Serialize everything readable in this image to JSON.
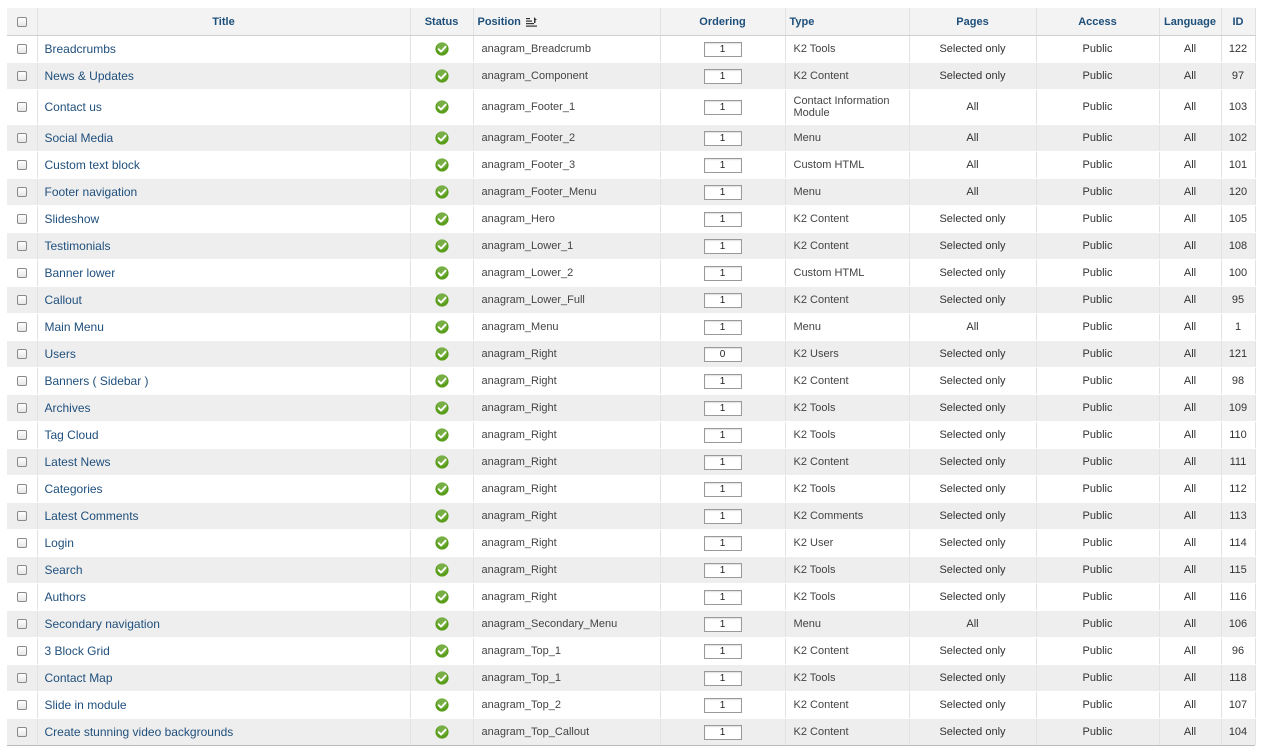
{
  "table": {
    "headers": {
      "title": "Title",
      "status": "Status",
      "position": "Position",
      "ordering": "Ordering",
      "type": "Type",
      "pages": "Pages",
      "access": "Access",
      "language": "Language",
      "id": "ID"
    },
    "status_color": "#5a9e1c",
    "rows": [
      {
        "title": "Breadcrumbs",
        "position": "anagram_Breadcrumb",
        "ordering": "1",
        "type": "K2 Tools",
        "pages": "Selected only",
        "access": "Public",
        "language": "All",
        "id": "122",
        "status": "published"
      },
      {
        "title": "News & Updates",
        "position": "anagram_Component",
        "ordering": "1",
        "type": "K2 Content",
        "pages": "Selected only",
        "access": "Public",
        "language": "All",
        "id": "97",
        "status": "published"
      },
      {
        "title": "Contact us",
        "position": "anagram_Footer_1",
        "ordering": "1",
        "type": "Contact Information Module",
        "pages": "All",
        "access": "Public",
        "language": "All",
        "id": "103",
        "status": "published"
      },
      {
        "title": "Social Media",
        "position": "anagram_Footer_2",
        "ordering": "1",
        "type": "Menu",
        "pages": "All",
        "access": "Public",
        "language": "All",
        "id": "102",
        "status": "published"
      },
      {
        "title": "Custom text block",
        "position": "anagram_Footer_3",
        "ordering": "1",
        "type": "Custom HTML",
        "pages": "All",
        "access": "Public",
        "language": "All",
        "id": "101",
        "status": "published"
      },
      {
        "title": "Footer navigation",
        "position": "anagram_Footer_Menu",
        "ordering": "1",
        "type": "Menu",
        "pages": "All",
        "access": "Public",
        "language": "All",
        "id": "120",
        "status": "published"
      },
      {
        "title": "Slideshow",
        "position": "anagram_Hero",
        "ordering": "1",
        "type": "K2 Content",
        "pages": "Selected only",
        "access": "Public",
        "language": "All",
        "id": "105",
        "status": "published"
      },
      {
        "title": "Testimonials",
        "position": "anagram_Lower_1",
        "ordering": "1",
        "type": "K2 Content",
        "pages": "Selected only",
        "access": "Public",
        "language": "All",
        "id": "108",
        "status": "published"
      },
      {
        "title": "Banner lower",
        "position": "anagram_Lower_2",
        "ordering": "1",
        "type": "Custom HTML",
        "pages": "Selected only",
        "access": "Public",
        "language": "All",
        "id": "100",
        "status": "published"
      },
      {
        "title": "Callout",
        "position": "anagram_Lower_Full",
        "ordering": "1",
        "type": "K2 Content",
        "pages": "Selected only",
        "access": "Public",
        "language": "All",
        "id": "95",
        "status": "published"
      },
      {
        "title": "Main Menu",
        "position": "anagram_Menu",
        "ordering": "1",
        "type": "Menu",
        "pages": "All",
        "access": "Public",
        "language": "All",
        "id": "1",
        "status": "published"
      },
      {
        "title": "Users",
        "position": "anagram_Right",
        "ordering": "0",
        "type": "K2 Users",
        "pages": "Selected only",
        "access": "Public",
        "language": "All",
        "id": "121",
        "status": "published"
      },
      {
        "title": "Banners ( Sidebar )",
        "position": "anagram_Right",
        "ordering": "1",
        "type": "K2 Content",
        "pages": "Selected only",
        "access": "Public",
        "language": "All",
        "id": "98",
        "status": "published"
      },
      {
        "title": "Archives",
        "position": "anagram_Right",
        "ordering": "1",
        "type": "K2 Tools",
        "pages": "Selected only",
        "access": "Public",
        "language": "All",
        "id": "109",
        "status": "published"
      },
      {
        "title": "Tag Cloud",
        "position": "anagram_Right",
        "ordering": "1",
        "type": "K2 Tools",
        "pages": "Selected only",
        "access": "Public",
        "language": "All",
        "id": "110",
        "status": "published"
      },
      {
        "title": "Latest News",
        "position": "anagram_Right",
        "ordering": "1",
        "type": "K2 Content",
        "pages": "Selected only",
        "access": "Public",
        "language": "All",
        "id": "111",
        "status": "published"
      },
      {
        "title": "Categories",
        "position": "anagram_Right",
        "ordering": "1",
        "type": "K2 Tools",
        "pages": "Selected only",
        "access": "Public",
        "language": "All",
        "id": "112",
        "status": "published"
      },
      {
        "title": "Latest Comments",
        "position": "anagram_Right",
        "ordering": "1",
        "type": "K2 Comments",
        "pages": "Selected only",
        "access": "Public",
        "language": "All",
        "id": "113",
        "status": "published"
      },
      {
        "title": "Login",
        "position": "anagram_Right",
        "ordering": "1",
        "type": "K2 User",
        "pages": "Selected only",
        "access": "Public",
        "language": "All",
        "id": "114",
        "status": "published"
      },
      {
        "title": "Search",
        "position": "anagram_Right",
        "ordering": "1",
        "type": "K2 Tools",
        "pages": "Selected only",
        "access": "Public",
        "language": "All",
        "id": "115",
        "status": "published"
      },
      {
        "title": "Authors",
        "position": "anagram_Right",
        "ordering": "1",
        "type": "K2 Tools",
        "pages": "Selected only",
        "access": "Public",
        "language": "All",
        "id": "116",
        "status": "published"
      },
      {
        "title": "Secondary navigation",
        "position": "anagram_Secondary_Menu",
        "ordering": "1",
        "type": "Menu",
        "pages": "All",
        "access": "Public",
        "language": "All",
        "id": "106",
        "status": "published"
      },
      {
        "title": "3 Block Grid",
        "position": "anagram_Top_1",
        "ordering": "1",
        "type": "K2 Content",
        "pages": "Selected only",
        "access": "Public",
        "language": "All",
        "id": "96",
        "status": "published"
      },
      {
        "title": "Contact Map",
        "position": "anagram_Top_1",
        "ordering": "1",
        "type": "K2 Tools",
        "pages": "Selected only",
        "access": "Public",
        "language": "All",
        "id": "118",
        "status": "published"
      },
      {
        "title": "Slide in module",
        "position": "anagram_Top_2",
        "ordering": "1",
        "type": "K2 Content",
        "pages": "Selected only",
        "access": "Public",
        "language": "All",
        "id": "107",
        "status": "published"
      },
      {
        "title": "Create stunning video backgrounds",
        "position": "anagram_Top_Callout",
        "ordering": "1",
        "type": "K2 Content",
        "pages": "Selected only",
        "access": "Public",
        "language": "All",
        "id": "104",
        "status": "published"
      }
    ]
  }
}
